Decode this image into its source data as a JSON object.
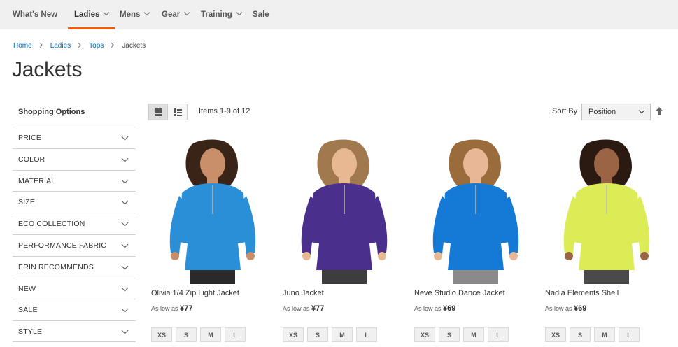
{
  "nav": {
    "items": [
      {
        "label": "What's New",
        "chevron": false
      },
      {
        "label": "Ladies",
        "chevron": true,
        "active": true
      },
      {
        "label": "Mens",
        "chevron": true
      },
      {
        "label": "Gear",
        "chevron": true
      },
      {
        "label": "Training",
        "chevron": true
      },
      {
        "label": "Sale",
        "chevron": false
      }
    ]
  },
  "breadcrumb": [
    "Home",
    "Ladies",
    "Tops",
    "Jackets"
  ],
  "page_title": "Jackets",
  "sidebar": {
    "title": "Shopping Options",
    "filters": [
      "PRICE",
      "COLOR",
      "MATERIAL",
      "SIZE",
      "ECO COLLECTION",
      "PERFORMANCE FABRIC",
      "ERIN RECOMMENDS",
      "NEW",
      "SALE",
      "STYLE"
    ]
  },
  "toolbar": {
    "amount": "Items 1-9 of 12",
    "sort_label": "Sort By",
    "sort_value": "Position",
    "view_modes": [
      "grid-icon",
      "list-icon"
    ]
  },
  "products": [
    {
      "name": "Olivia 1/4 Zip Light Jacket",
      "price_prefix": "As low as",
      "price": "¥77",
      "sizes": [
        "XS",
        "S",
        "M",
        "L"
      ],
      "color": "#2b8fd8",
      "skin": "#c98e6a",
      "hair": "#3a2418",
      "pants": "#2a2a2a"
    },
    {
      "name": "Juno Jacket",
      "price_prefix": "As low as",
      "price": "¥77",
      "sizes": [
        "XS",
        "S",
        "M",
        "L"
      ],
      "color": "#4b2f8c",
      "skin": "#e7b892",
      "hair": "#a07a4e",
      "pants": "#3d3d3d"
    },
    {
      "name": "Neve Studio Dance Jacket",
      "price_prefix": "As low as",
      "price": "¥69",
      "sizes": [
        "XS",
        "S",
        "M",
        "L"
      ],
      "color": "#1579d6",
      "skin": "#e8b896",
      "hair": "#9a6b3b",
      "pants": "#8a8a8a"
    },
    {
      "name": "Nadia Elements Shell",
      "price_prefix": "As low as",
      "price": "¥69",
      "sizes": [
        "XS",
        "S",
        "M",
        "L"
      ],
      "color": "#dcec56",
      "skin": "#9a6445",
      "hair": "#2b1a12",
      "pants": "#4a4a4a"
    }
  ],
  "colors": {
    "accent": "#ff5501",
    "link": "#006bb4"
  }
}
